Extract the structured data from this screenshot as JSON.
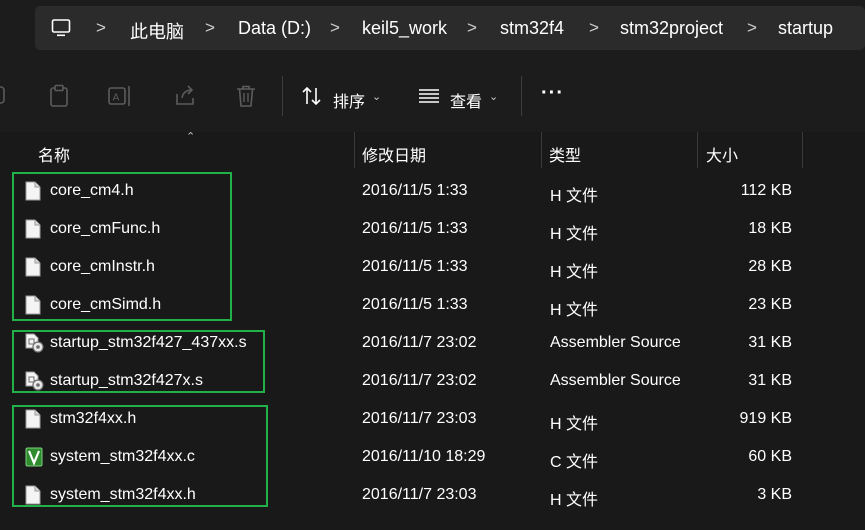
{
  "address_bar": {
    "pc_icon": "computer-icon",
    "crumbs": [
      "此电脑",
      "Data (D:)",
      "keil5_work",
      "stm32f4",
      "stm32project",
      "startup"
    ],
    "separator": ">"
  },
  "toolbar": {
    "sort_label": "排序",
    "view_label": "查看",
    "more_label": "···",
    "icons": [
      "new-icon",
      "paste-icon",
      "rename-icon",
      "share-icon",
      "delete-icon",
      "sort-icon",
      "view-icon"
    ]
  },
  "columns": {
    "name": "名称",
    "date": "修改日期",
    "type": "类型",
    "size": "大小"
  },
  "files": [
    {
      "name": "core_cm4.h",
      "date": "2016/11/5 1:33",
      "type": "H 文件",
      "size": "112 KB",
      "icon": "document-icon"
    },
    {
      "name": "core_cmFunc.h",
      "date": "2016/11/5 1:33",
      "type": "H 文件",
      "size": "18 KB",
      "icon": "document-icon"
    },
    {
      "name": "core_cmInstr.h",
      "date": "2016/11/5 1:33",
      "type": "H 文件",
      "size": "28 KB",
      "icon": "document-icon"
    },
    {
      "name": "core_cmSimd.h",
      "date": "2016/11/5 1:33",
      "type": "H 文件",
      "size": "23 KB",
      "icon": "document-icon"
    },
    {
      "name": "startup_stm32f427_437xx.s",
      "date": "2016/11/7 23:02",
      "type": "Assembler Source",
      "size": "31 KB",
      "icon": "assembler-icon"
    },
    {
      "name": "startup_stm32f427x.s",
      "date": "2016/11/7 23:02",
      "type": "Assembler Source",
      "size": "31 KB",
      "icon": "assembler-icon"
    },
    {
      "name": "stm32f4xx.h",
      "date": "2016/11/7 23:03",
      "type": "H 文件",
      "size": "919 KB",
      "icon": "document-icon"
    },
    {
      "name": "system_stm32f4xx.c",
      "date": "2016/11/10 18:29",
      "type": "C 文件",
      "size": "60 KB",
      "icon": "keil-c-icon"
    },
    {
      "name": "system_stm32f4xx.h",
      "date": "2016/11/7 23:03",
      "type": "H 文件",
      "size": "3 KB",
      "icon": "document-icon"
    }
  ],
  "highlight_color": "#22b04b"
}
